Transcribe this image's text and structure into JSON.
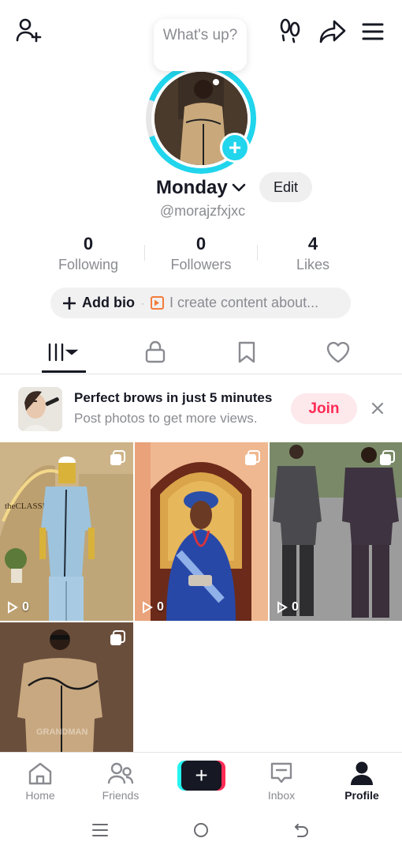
{
  "top_bar": {
    "icons": [
      "add-friend-icon",
      "footprints-icon",
      "share-icon",
      "menu-icon"
    ]
  },
  "bubble": {
    "text": "What's up?"
  },
  "profile": {
    "name": "Monday",
    "edit_label": "Edit",
    "handle": "@morajzfxjxc"
  },
  "stats": [
    {
      "value": "0",
      "label": "Following"
    },
    {
      "value": "0",
      "label": "Followers"
    },
    {
      "value": "4",
      "label": "Likes"
    }
  ],
  "bio": {
    "add_label": "Add bio",
    "separator": "·",
    "hint": "I create content about..."
  },
  "tabs": [
    "videos-grid-icon",
    "lock-icon",
    "bookmark-icon",
    "heart-icon"
  ],
  "promo": {
    "title": "Perfect brows in just 5 minutes",
    "subtitle": "Post photos to get more views.",
    "join_label": "Join"
  },
  "videos": [
    {
      "views": "0",
      "sign_text": "theCLASSIC"
    },
    {
      "views": "0"
    },
    {
      "views": "0"
    },
    {
      "views": "",
      "watermark": "GRANDMAN"
    }
  ],
  "bottom_nav": {
    "items": [
      {
        "label": "Home"
      },
      {
        "label": "Friends"
      },
      {
        "label": "Inbox"
      },
      {
        "label": "Profile"
      }
    ]
  },
  "colors": {
    "accent_cyan": "#20d5ec",
    "brand_red": "#fe2c55",
    "text_primary": "#161823",
    "text_secondary": "#8a8b91"
  }
}
